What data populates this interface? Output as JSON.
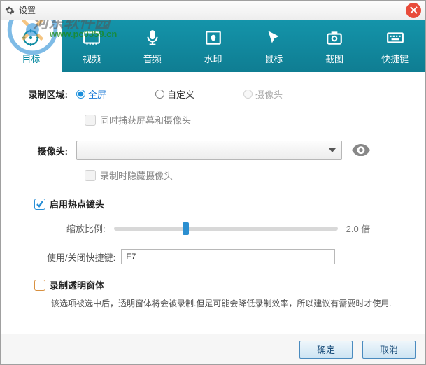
{
  "window": {
    "title": "设置"
  },
  "watermark": {
    "text1": "河东软件园",
    "text2": "www.pc0359.cn"
  },
  "tabs": [
    {
      "id": "target",
      "label": "目标",
      "active": true
    },
    {
      "id": "video",
      "label": "视频"
    },
    {
      "id": "audio",
      "label": "音频"
    },
    {
      "id": "watermark",
      "label": "水印"
    },
    {
      "id": "mouse",
      "label": "鼠标"
    },
    {
      "id": "screenshot",
      "label": "截图"
    },
    {
      "id": "hotkey",
      "label": "快捷键"
    }
  ],
  "record_area": {
    "label": "录制区域:",
    "options": {
      "fullscreen": "全屏",
      "custom": "自定义",
      "camera": "摄像头"
    },
    "selected": "fullscreen",
    "capture_both_label": "同时捕获屏幕和摄像头"
  },
  "camera": {
    "label": "摄像头:",
    "hide_when_recording_label": "录制时隐藏摄像头"
  },
  "hotspot": {
    "enable_label": "启用热点镜头",
    "zoom_label": "缩放比例:",
    "zoom_value": "2.0 倍",
    "hotkey_label": "使用/关闭快捷键:",
    "hotkey_value": "F7"
  },
  "transparent": {
    "label": "录制透明窗体",
    "desc": "该选项被选中后，透明窗体将会被录制.但是可能会降低录制效率，所以建议有需要时才使用."
  },
  "buttons": {
    "ok": "确定",
    "cancel": "取消"
  }
}
